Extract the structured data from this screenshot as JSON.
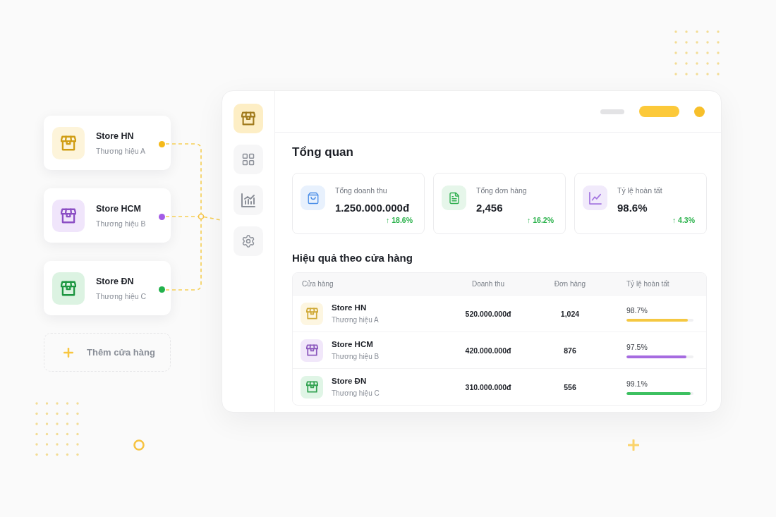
{
  "store_cards": [
    {
      "name": "Store HN",
      "brand": "Thương hiệu A",
      "color": "#f5b918"
    },
    {
      "name": "Store HCM",
      "brand": "Thương hiệu B",
      "color": "#a35ce6"
    },
    {
      "name": "Store ĐN",
      "brand": "Thương hiệu C",
      "color": "#22b14c"
    }
  ],
  "add_store_button": {
    "label": "Thêm cửa hàng"
  },
  "sidebar": {
    "items": [
      {
        "selected": true
      },
      {
        "selected": false
      },
      {
        "selected": false
      },
      {
        "selected": false
      }
    ]
  },
  "overview": {
    "title": "Tổng quan",
    "stats": [
      {
        "label": "Tổng doanh thu",
        "value": "1.250.000.000đ",
        "change": "↑ 18.6%"
      },
      {
        "label": "Tổng đơn hàng",
        "value": "2,456",
        "change": "↑ 16.2%"
      },
      {
        "label": "Tỷ lệ hoàn tất",
        "value": "98.6%",
        "change": "↑ 4.3%"
      }
    ]
  },
  "store_performance": {
    "title": "Hiệu quả theo cửa hàng",
    "table": {
      "columns": [
        "Cửa hàng",
        "Doanh thu",
        "Đơn hàng",
        "Tỷ lệ hoàn tất"
      ],
      "rows": [
        {
          "name": "Store HN",
          "brand": "Thương hiệu A",
          "revenue": "520.000.000đ",
          "orders": "1,024",
          "rate": "98.7%",
          "level": 0.92,
          "color": "#f5c842"
        },
        {
          "name": "Store HCM",
          "brand": "Thương hiệu B",
          "revenue": "420.000.000đ",
          "orders": "876",
          "rate": "97.5%",
          "level": 0.89,
          "color": "#a66be0"
        },
        {
          "name": "Store ĐN",
          "brand": "Thương hiệu C",
          "revenue": "310.000.000đ",
          "orders": "556",
          "rate": "99.1%",
          "level": 0.96,
          "color": "#3cc060"
        }
      ]
    }
  }
}
